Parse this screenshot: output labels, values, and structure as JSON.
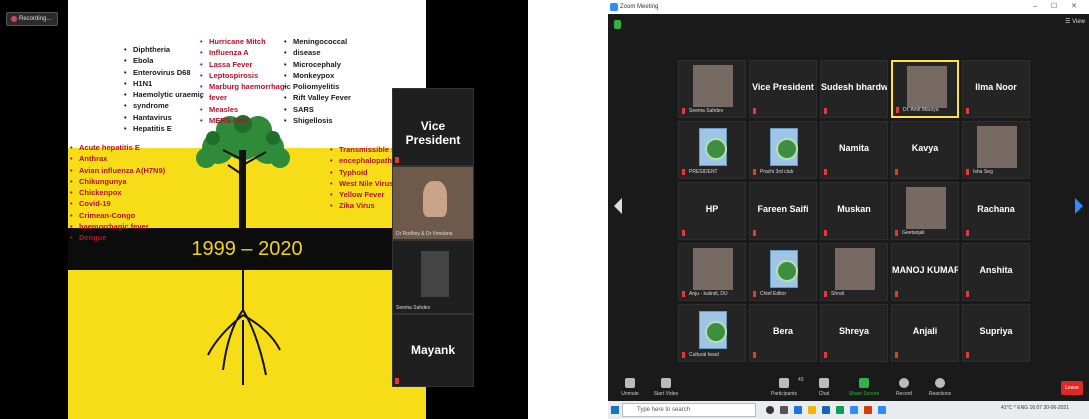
{
  "left": {
    "recording_label": "Recording...",
    "slide": {
      "year_range": "1999 – 2020",
      "col1": [
        "Diphtheria",
        "Ebola",
        "Enterovirus D68",
        "H1N1",
        "Haemolytic uraemic",
        "syndrome",
        "Hantavirus",
        "Hepatitis E"
      ],
      "col2": [
        "Hurricane Mitch",
        "Influenza A",
        "Lassa Fever",
        "Leptospirosis",
        "Marburg haemorrhagic",
        "fever",
        "Measles",
        "MERS-CoV"
      ],
      "col3": [
        "Meningococcal",
        "disease",
        "Microcephaly",
        "Monkeypox",
        "Poliomyelitis",
        "Rift Valley Fever",
        "SARS",
        "Shigellosis"
      ],
      "col_left": [
        "Acute hepatitis E",
        "Anthrax",
        "Avian influenza A(H7N9)",
        "Chikungunya",
        "Chickenpox",
        "Covid-19",
        "Crimean-Congo",
        "haemorrhagic fever",
        "Dengue"
      ],
      "col_right": [
        "Transmissible spo",
        "encephalopathies",
        "Typhoid",
        "West Nile Virus In",
        "Yellow Fever",
        "Zika Virus"
      ]
    },
    "participants": [
      {
        "name": "Vice President",
        "caption": ""
      },
      {
        "name": "",
        "caption": "Dr Rodhey & Dr Vondana"
      },
      {
        "name": "",
        "caption": "Seema Sahdev"
      },
      {
        "name": "Mayank",
        "caption": ""
      }
    ]
  },
  "right": {
    "window_title": "Zoom Meeting",
    "window_controls": "– ☐ ✕",
    "view_label": "☰ View",
    "tiles": [
      {
        "name": "",
        "caption": "Seema Sahdev",
        "kind": "photo"
      },
      {
        "name": "Vice President",
        "caption": "",
        "kind": "name"
      },
      {
        "name": "Sudesh bhardwaj",
        "caption": "",
        "kind": "name"
      },
      {
        "name": "",
        "caption": "Dr. Amit Maurya",
        "kind": "photo",
        "active": true
      },
      {
        "name": "Ilma Noor",
        "caption": "",
        "kind": "name"
      },
      {
        "name": "",
        "caption": "PRESIDENT",
        "kind": "logo"
      },
      {
        "name": "",
        "caption": "Prachi 3rd club",
        "kind": "logo"
      },
      {
        "name": "Namita",
        "caption": "",
        "kind": "name"
      },
      {
        "name": "Kavya",
        "caption": "",
        "kind": "name"
      },
      {
        "name": "",
        "caption": "Isha Seg",
        "kind": "photo"
      },
      {
        "name": "HP",
        "caption": "",
        "kind": "name"
      },
      {
        "name": "Fareen Saifi",
        "caption": "",
        "kind": "name"
      },
      {
        "name": "Muskan",
        "caption": "",
        "kind": "name"
      },
      {
        "name": "",
        "caption": "Geetanjali",
        "kind": "photo"
      },
      {
        "name": "Rachana",
        "caption": "",
        "kind": "name"
      },
      {
        "name": "",
        "caption": "Anju - kalindi, DU",
        "kind": "photo"
      },
      {
        "name": "",
        "caption": "Chief Editor",
        "kind": "logo"
      },
      {
        "name": "",
        "caption": "Shruti",
        "kind": "photo"
      },
      {
        "name": "MANOJ KUMAR",
        "caption": "",
        "kind": "name"
      },
      {
        "name": "Anshita",
        "caption": "",
        "kind": "name"
      },
      {
        "name": "",
        "caption": "Cultural head",
        "kind": "logo"
      },
      {
        "name": "Bera",
        "caption": "",
        "kind": "name"
      },
      {
        "name": "Shreya",
        "caption": "",
        "kind": "name"
      },
      {
        "name": "Anjali",
        "caption": "",
        "kind": "name"
      },
      {
        "name": "Supriya",
        "caption": "",
        "kind": "name"
      }
    ],
    "toolbar": {
      "unmute": "Unmute",
      "start_video": "Start Video",
      "participants": "Participants",
      "participants_count": "43",
      "chat": "Chat",
      "share_screen": "Share Screen",
      "record": "Record",
      "reactions": "Reactions",
      "leave": "Leave"
    },
    "taskbar": {
      "search_placeholder": "Type here to search",
      "tray": "41°C  ^  ENG  16:07",
      "date": "30-06-2021"
    },
    "colors": {
      "accent": "#2d8cff",
      "active_speaker": "#ffe24a",
      "leave": "#e02828",
      "slide_yellow": "#f7dd18"
    }
  }
}
